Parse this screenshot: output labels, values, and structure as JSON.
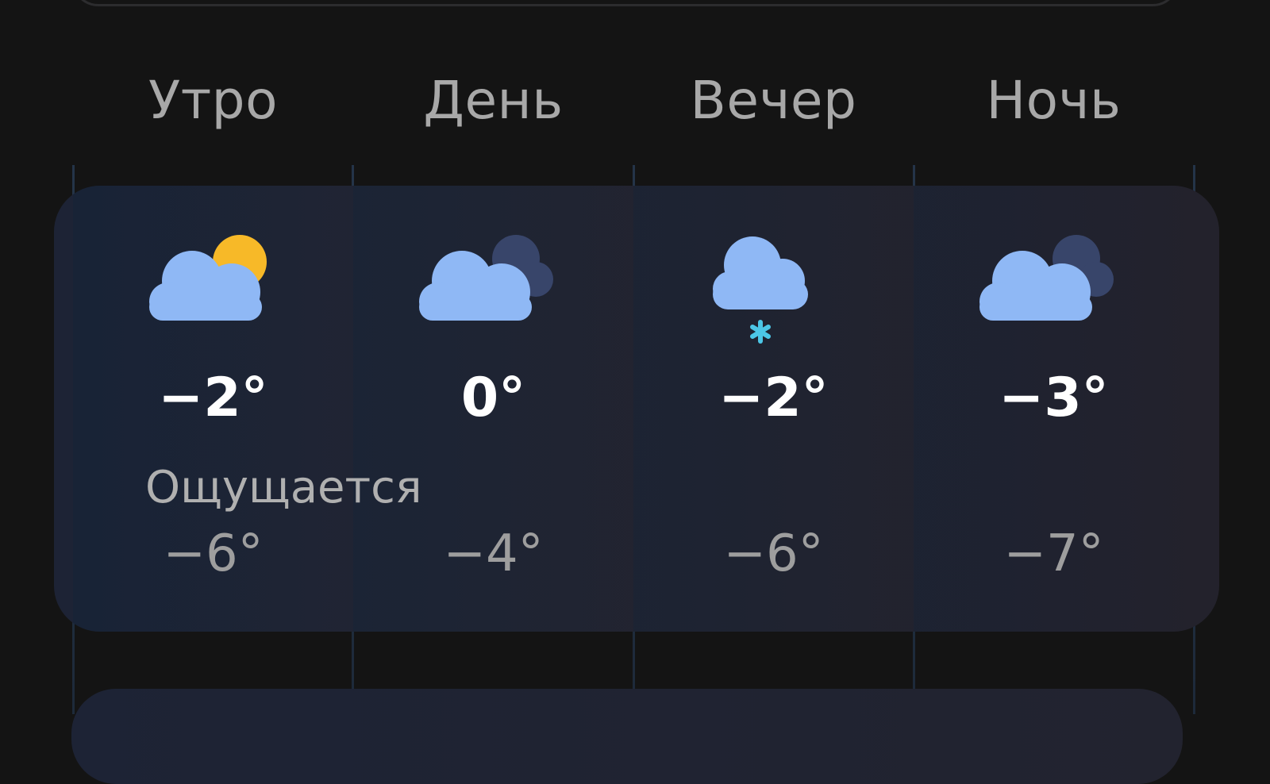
{
  "periods": [
    {
      "name": "Утро",
      "temp": "−2°",
      "feels": "−6°",
      "icon": "partly-cloudy-sun-icon"
    },
    {
      "name": "День",
      "temp": "0°",
      "feels": "−4°",
      "icon": "cloudy-icon"
    },
    {
      "name": "Вечер",
      "temp": "−2°",
      "feels": "−6°",
      "icon": "cloud-snow-icon"
    },
    {
      "name": "Ночь",
      "temp": "−3°",
      "feels": "−7°",
      "icon": "cloudy-icon"
    }
  ],
  "feels_label": "Ощущается",
  "colors": {
    "background": "#141414",
    "card": "#212433",
    "sun": "#f7b928",
    "cloud": "#8fb8f5",
    "snow": "#4cc6e6"
  }
}
